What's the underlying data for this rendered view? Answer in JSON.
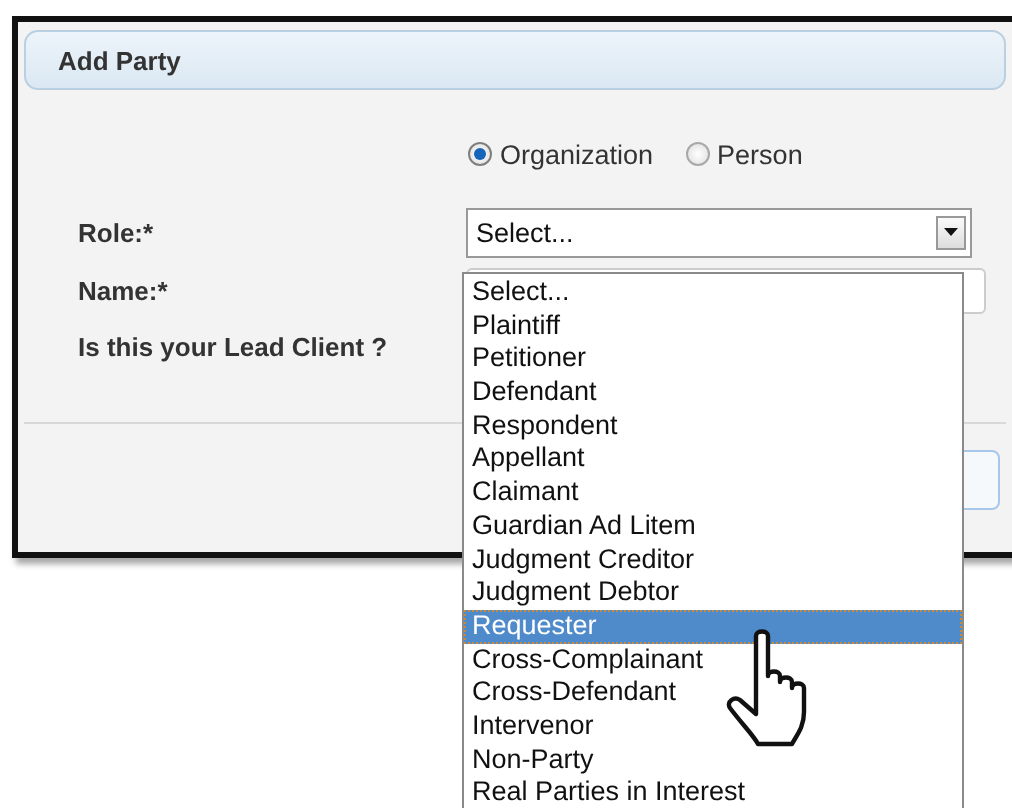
{
  "dialog": {
    "title": "Add Party",
    "party_type": [
      {
        "label": "Organization",
        "selected": true
      },
      {
        "label": "Person",
        "selected": false
      }
    ],
    "fields": [
      {
        "label": "Role:*",
        "kind": "select",
        "value": "Select..."
      },
      {
        "label": "Name:*",
        "kind": "text"
      },
      {
        "label": "Is this your Lead Client ?",
        "kind": "label"
      }
    ]
  },
  "dropdown": {
    "options": [
      {
        "label": "Select...",
        "selected": false
      },
      {
        "label": "Plaintiff",
        "selected": false
      },
      {
        "label": "Petitioner",
        "selected": false
      },
      {
        "label": "Defendant",
        "selected": false
      },
      {
        "label": "Respondent",
        "selected": false
      },
      {
        "label": "Appellant",
        "selected": false
      },
      {
        "label": "Claimant",
        "selected": false
      },
      {
        "label": "Guardian Ad Litem",
        "selected": false
      },
      {
        "label": "Judgment Creditor",
        "selected": false
      },
      {
        "label": "Judgment Debtor",
        "selected": false
      },
      {
        "label": "Requester",
        "selected": true
      },
      {
        "label": "Cross-Complainant",
        "selected": false
      },
      {
        "label": "Cross-Defendant",
        "selected": false
      },
      {
        "label": "Intervenor",
        "selected": false
      },
      {
        "label": "Non-Party",
        "selected": false
      },
      {
        "label": "Real Parties in Interest",
        "selected": false
      }
    ]
  }
}
